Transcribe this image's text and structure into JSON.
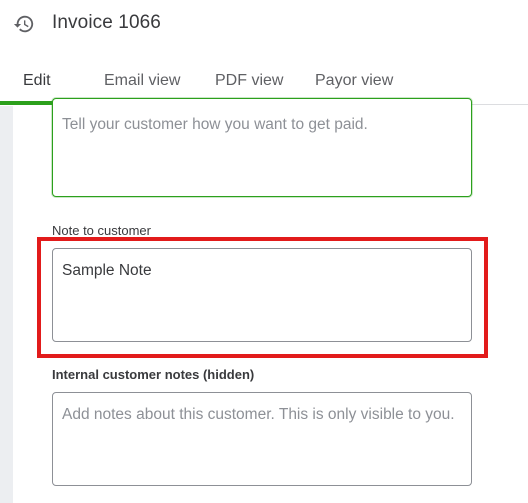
{
  "header": {
    "title": "Invoice 1066",
    "history_icon": "history-icon"
  },
  "tabs": [
    {
      "label": "Edit",
      "active": true
    },
    {
      "label": "Email view",
      "active": false
    },
    {
      "label": "PDF view",
      "active": false
    },
    {
      "label": "Payor view",
      "active": false
    }
  ],
  "form": {
    "payment_message": {
      "placeholder": "Tell your customer how you want to get paid.",
      "value": ""
    },
    "note_to_customer": {
      "label": "Note to customer",
      "value": "Sample Note"
    },
    "internal_notes": {
      "label": "Internal customer notes (hidden)",
      "placeholder": "Add notes about this customer. This is only visible to you.",
      "value": ""
    }
  },
  "colors": {
    "accent": "#2ca01c",
    "highlight": "#e21b1b",
    "text": "#393a3d",
    "placeholder": "#8d9096"
  }
}
